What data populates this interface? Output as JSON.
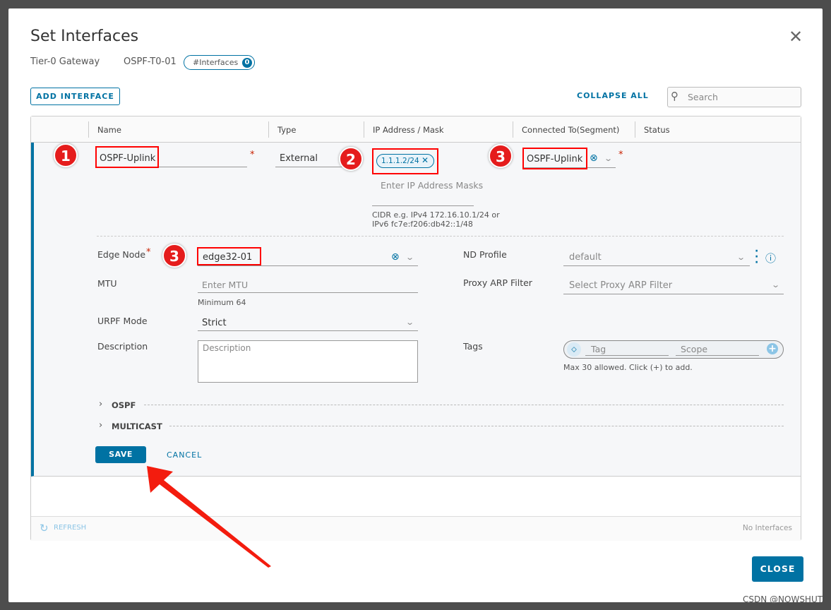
{
  "modal": {
    "title": "Set Interfaces",
    "gateway_type": "Tier-0 Gateway",
    "gateway_name": "OSPF-T0-01",
    "interfaces_badge_label": "#Interfaces",
    "interfaces_count": "0"
  },
  "toolbar": {
    "add_interface": "ADD INTERFACE",
    "collapse_all": "COLLAPSE ALL",
    "search_placeholder": "Search"
  },
  "table": {
    "columns": [
      "Name",
      "Type",
      "IP Address / Mask",
      "Connected To(Segment)",
      "Status"
    ],
    "row": {
      "name": "OSPF-Uplink",
      "type": "External",
      "ip_chip": "1.1.1.2/24",
      "ip_placeholder": "Enter IP Address Masks",
      "ip_hint_1": "CIDR e.g. IPv4 172.16.10.1/24 or",
      "ip_hint_2": "IPv6 fc7e:f206:db42::1/48",
      "segment": "OSPF-Uplink"
    },
    "footer": {
      "refresh": "REFRESH",
      "status": "No Interfaces"
    }
  },
  "form": {
    "edge_node_label": "Edge Node",
    "edge_node_value": "edge32-01",
    "mtu_label": "MTU",
    "mtu_placeholder": "Enter MTU",
    "mtu_hint": "Minimum 64",
    "urpf_label": "URPF Mode",
    "urpf_value": "Strict",
    "description_label": "Description",
    "description_placeholder": "Description",
    "nd_profile_label": "ND Profile",
    "nd_profile_value": "default",
    "proxy_arp_label": "Proxy ARP Filter",
    "proxy_arp_placeholder": "Select Proxy ARP Filter",
    "tags_label": "Tags",
    "tag_placeholder": "Tag",
    "scope_placeholder": "Scope",
    "tags_hint": "Max 30 allowed. Click (+) to add.",
    "required_mark": "*"
  },
  "sections": {
    "ospf": "OSPF",
    "multicast": "MULTICAST"
  },
  "actions": {
    "save": "SAVE",
    "cancel": "CANCEL",
    "close": "CLOSE"
  },
  "annotations": {
    "b1": "1",
    "b2": "2",
    "b3a": "3",
    "b3b": "3"
  },
  "watermark": "CSDN @NOWSHUT",
  "colors": {
    "accent": "#0072a3",
    "annotation": "#e51c1c"
  }
}
